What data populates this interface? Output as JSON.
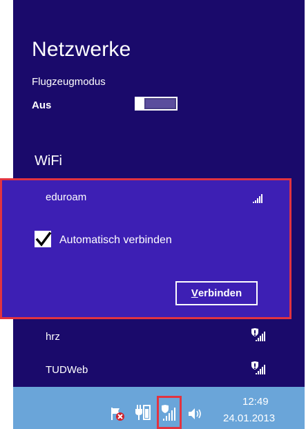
{
  "panel": {
    "title": "Netzwerke",
    "airplane_mode": {
      "label": "Flugzeugmodus",
      "state": "Aus"
    },
    "wifi_header": "WiFi",
    "networks": [
      {
        "name": "eduroam",
        "secured": false,
        "selected": true
      },
      {
        "name": "hrz",
        "secured": true,
        "selected": false
      },
      {
        "name": "TUDWeb",
        "secured": true,
        "selected": false
      }
    ],
    "auto_connect": {
      "label": "Automatisch verbinden",
      "checked": true
    },
    "connect_button": {
      "accel": "V",
      "rest": "erbinden"
    }
  },
  "taskbar": {
    "time": "12:49",
    "date": "24.01.2013",
    "icons": [
      "action-center-flag-icon",
      "power-plug-icon",
      "network-signal-icon",
      "speaker-icon"
    ]
  },
  "colors": {
    "panel_bg": "#1a0a6b",
    "selected_bg": "#3d1fb4",
    "highlight": "#e23340",
    "taskbar_bg": "#6aa5d9"
  }
}
